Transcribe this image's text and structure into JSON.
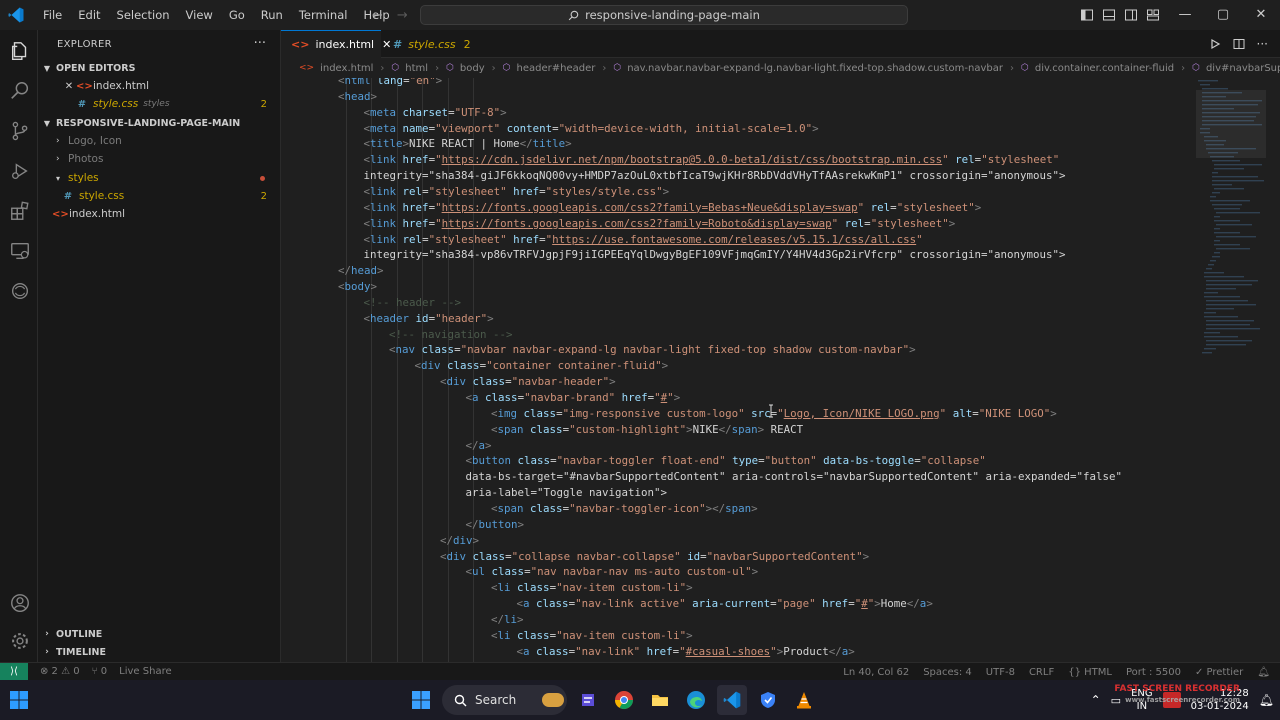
{
  "titlebar": {
    "menu": [
      "File",
      "Edit",
      "Selection",
      "View",
      "Go",
      "Run",
      "Terminal",
      "Help"
    ],
    "search_text": "responsive-landing-page-main",
    "win_minimize": "—",
    "win_maximize": "▢",
    "win_close": "✕"
  },
  "sidebar": {
    "title": "EXPLORER",
    "more": "···",
    "open_editors": {
      "title": "OPEN EDITORS",
      "items": [
        {
          "name": "index.html",
          "path": ""
        },
        {
          "name": "style.css",
          "path": "styles",
          "badge": "2"
        }
      ]
    },
    "project": {
      "title": "RESPONSIVE-LANDING-PAGE-MAIN",
      "items": [
        {
          "name": "Logo, Icon"
        },
        {
          "name": "Photos"
        },
        {
          "name": "styles"
        },
        {
          "name": "style.css",
          "badge": "2"
        },
        {
          "name": "index.html"
        }
      ]
    },
    "outline": "OUTLINE",
    "timeline": "TIMELINE"
  },
  "tabs": [
    {
      "label": "index.html",
      "close": "✕"
    },
    {
      "label": "style.css",
      "badge": "2"
    }
  ],
  "breadcrumb": [
    "index.html",
    "html",
    "body",
    "header#header",
    "nav.navbar.navbar-expand-lg.navbar-light.fixed-top.shadow.custom-navbar",
    "div.container.container-fluid",
    "div#navbarSupportedContent"
  ],
  "code": {
    "lines": [
      "<html lang=\"en\">",
      "<head>",
      "<meta charset=\"UTF-8\">",
      "<meta name=\"viewport\" content=\"width=device-width, initial-scale=1.0\">",
      "<title>NIKE REACT | Home</title>",
      "<link href=\"https://cdn.jsdelivr.net/npm/bootstrap@5.0.0-beta1/dist/css/bootstrap.min.css\" rel=\"stylesheet\"",
      "integrity=\"sha384-giJF6kkoqNQ00vy+HMDP7azOuL0xtbfIcaT9wjKHr8RbDVddVHyTfAAsrekwKmP1\" crossorigin=\"anonymous\">",
      "<link rel=\"stylesheet\" href=\"styles/style.css\">",
      "<link href=\"https://fonts.googleapis.com/css2?family=Bebas+Neue&display=swap\" rel=\"stylesheet\">",
      "<link href=\"https://fonts.googleapis.com/css2?family=Roboto&display=swap\" rel=\"stylesheet\">",
      "<link rel=\"stylesheet\" href=\"https://use.fontawesome.com/releases/v5.15.1/css/all.css\"",
      "integrity=\"sha384-vp86vTRFVJgpjF9jiIGPEEqYqlDwgyBgEF109VFjmqGmIY/Y4HV4d3Gp2irVfcrp\" crossorigin=\"anonymous\">",
      "</head>",
      "<body>",
      "<!-- header -->",
      "<header id=\"header\">",
      "<!-- navigation -->",
      "<nav class=\"navbar navbar-expand-lg navbar-light fixed-top shadow custom-navbar\">",
      "<div class=\"container container-fluid\">",
      "<div class=\"navbar-header\">",
      "<a class=\"navbar-brand\" href=\"#\">",
      "<img class=\"img-responsive custom-logo\" src=\"Logo, Icon/NIKE LOGO.png\" alt=\"NIKE LOGO\">",
      "<span class=\"custom-highlight\">NIKE</span> REACT",
      "</a>",
      "<button class=\"navbar-toggler float-end\" type=\"button\" data-bs-toggle=\"collapse\"",
      "data-bs-target=\"#navbarSupportedContent\" aria-controls=\"navbarSupportedContent\" aria-expanded=\"false\"",
      "aria-label=\"Toggle navigation\">",
      "<span class=\"navbar-toggler-icon\"></span>",
      "</button>",
      "</div>",
      "<div class=\"collapse navbar-collapse\" id=\"navbarSupportedContent\">",
      "<ul class=\"nav navbar-nav ms-auto custom-ul\">",
      "<li class=\"nav-item custom-li\">",
      "<a class=\"nav-link active\" aria-current=\"page\" href=\"#\">Home</a>",
      "</li>",
      "<li class=\"nav-item custom-li\">",
      "<a class=\"nav-link\" href=\"#casual-shoes\">Product</a>"
    ]
  },
  "statusbar": {
    "errors": "⊗ 2 ⚠ 0",
    "ports": "⑂ 0",
    "live_share": "Live Share",
    "position": "Ln 40, Col 62",
    "spaces": "Spaces: 4",
    "encoding": "UTF-8",
    "eol": "CRLF",
    "language": "{} HTML",
    "port": "Port : 5500",
    "prettier": "✓ Prettier"
  },
  "taskbar": {
    "search": "Search",
    "lang_top": "ENG",
    "lang_bottom": "IN",
    "time": "12:28",
    "date": "03-01-2024"
  },
  "watermark": {
    "line1": "FAST SCREEN RECORDER",
    "line2": "www.fastscreenrecorder.com"
  },
  "colors": {
    "accent": "#0078d4",
    "editor_bg": "#1f1f1f",
    "warning": "#cca700",
    "html_icon": "#e44d26",
    "css_icon": "#519aba"
  }
}
